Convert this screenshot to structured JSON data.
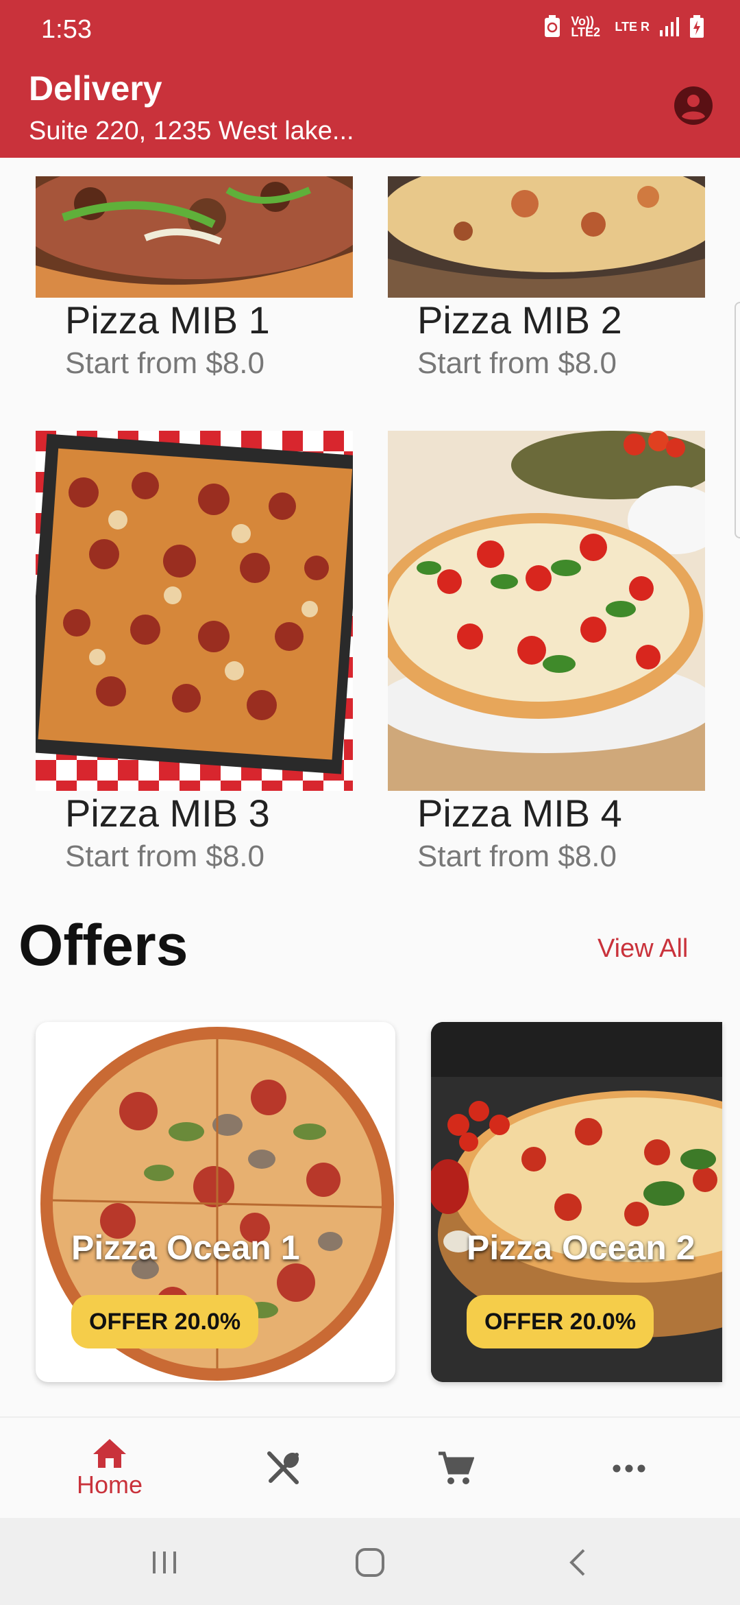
{
  "status_bar": {
    "time": "1:53",
    "volte": "Vo)) LTE2",
    "lte": "LTE R"
  },
  "header": {
    "title": "Delivery",
    "address": "Suite 220, 1235 West lake...",
    "account_icon": "account-circle-icon"
  },
  "pizzas": [
    {
      "name": "Pizza MIB 1",
      "price": "Start from $8.0"
    },
    {
      "name": "Pizza MIB 2",
      "price": "Start from $8.0"
    },
    {
      "name": "Pizza MIB 3",
      "price": "Start from $8.0"
    },
    {
      "name": "Pizza MIB 4",
      "price": "Start from $8.0"
    }
  ],
  "offers": {
    "title": "Offers",
    "view_all": "View All",
    "items": [
      {
        "name": "Pizza Ocean 1",
        "badge": "OFFER 20.0%"
      },
      {
        "name": "Pizza Ocean 2",
        "badge": "OFFER 20.0%"
      }
    ]
  },
  "bottom_nav": {
    "home_label": "Home",
    "items": [
      "home-icon",
      "restaurant-menu-icon",
      "cart-icon",
      "more-icon"
    ]
  },
  "colors": {
    "brand": "#c9323b",
    "badge": "#f5cd4a"
  }
}
